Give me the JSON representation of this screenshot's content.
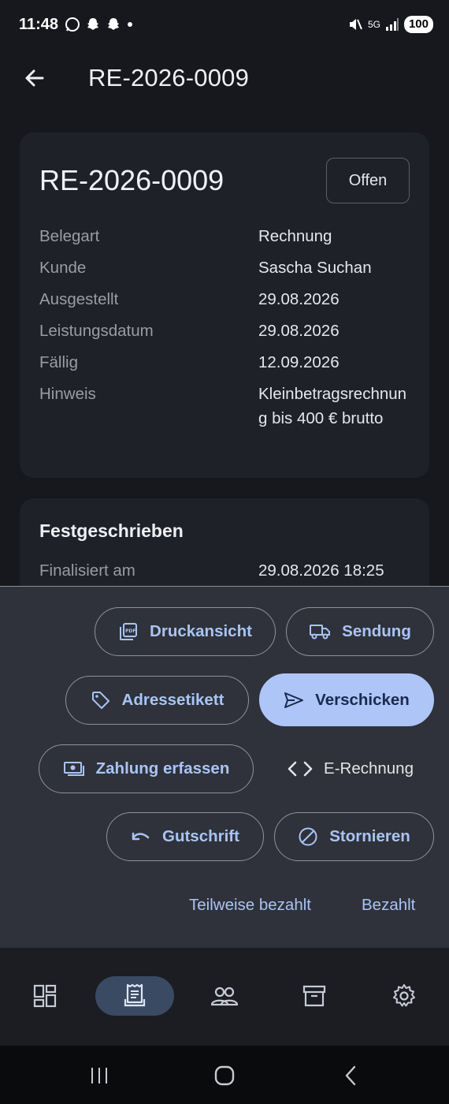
{
  "status_bar": {
    "time": "11:48",
    "network": "5G",
    "battery": "100"
  },
  "app_bar": {
    "title": "RE-2026-0009"
  },
  "document": {
    "number": "RE-2026-0009",
    "status": "Offen",
    "details": [
      {
        "label": "Belegart",
        "value": "Rechnung"
      },
      {
        "label": "Kunde",
        "value": "Sascha Suchan"
      },
      {
        "label": "Ausgestellt",
        "value": "29.08.2026"
      },
      {
        "label": "Leistungsdatum",
        "value": "29.08.2026"
      },
      {
        "label": "Fällig",
        "value": "12.09.2026"
      },
      {
        "label": "Hinweis",
        "value": "Kleinbetragsrechnung bis 400 € brutto"
      }
    ]
  },
  "finalized": {
    "title": "Festgeschrieben",
    "label": "Finalisiert am",
    "value": "29.08.2026 18:25"
  },
  "actions": {
    "print_preview": "Druckansicht",
    "shipment": "Sendung",
    "address_label": "Adressetikett",
    "send": "Verschicken",
    "record_payment": "Zahlung erfassen",
    "e_invoice": "E-Rechnung",
    "credit_note": "Gutschrift",
    "cancel": "Stornieren",
    "partially_paid": "Teilweise bezahlt",
    "paid": "Bezahlt"
  },
  "bottom_nav": {
    "items": [
      "dashboard-icon",
      "receipt-icon",
      "people-icon",
      "archive-icon",
      "settings-icon"
    ],
    "active_index": 1
  },
  "colors": {
    "accent": "#aec6f7",
    "accent_text": "#a9c4f5",
    "background": "#16181d",
    "card": "#1f2128",
    "sheet": "#2f323a"
  }
}
